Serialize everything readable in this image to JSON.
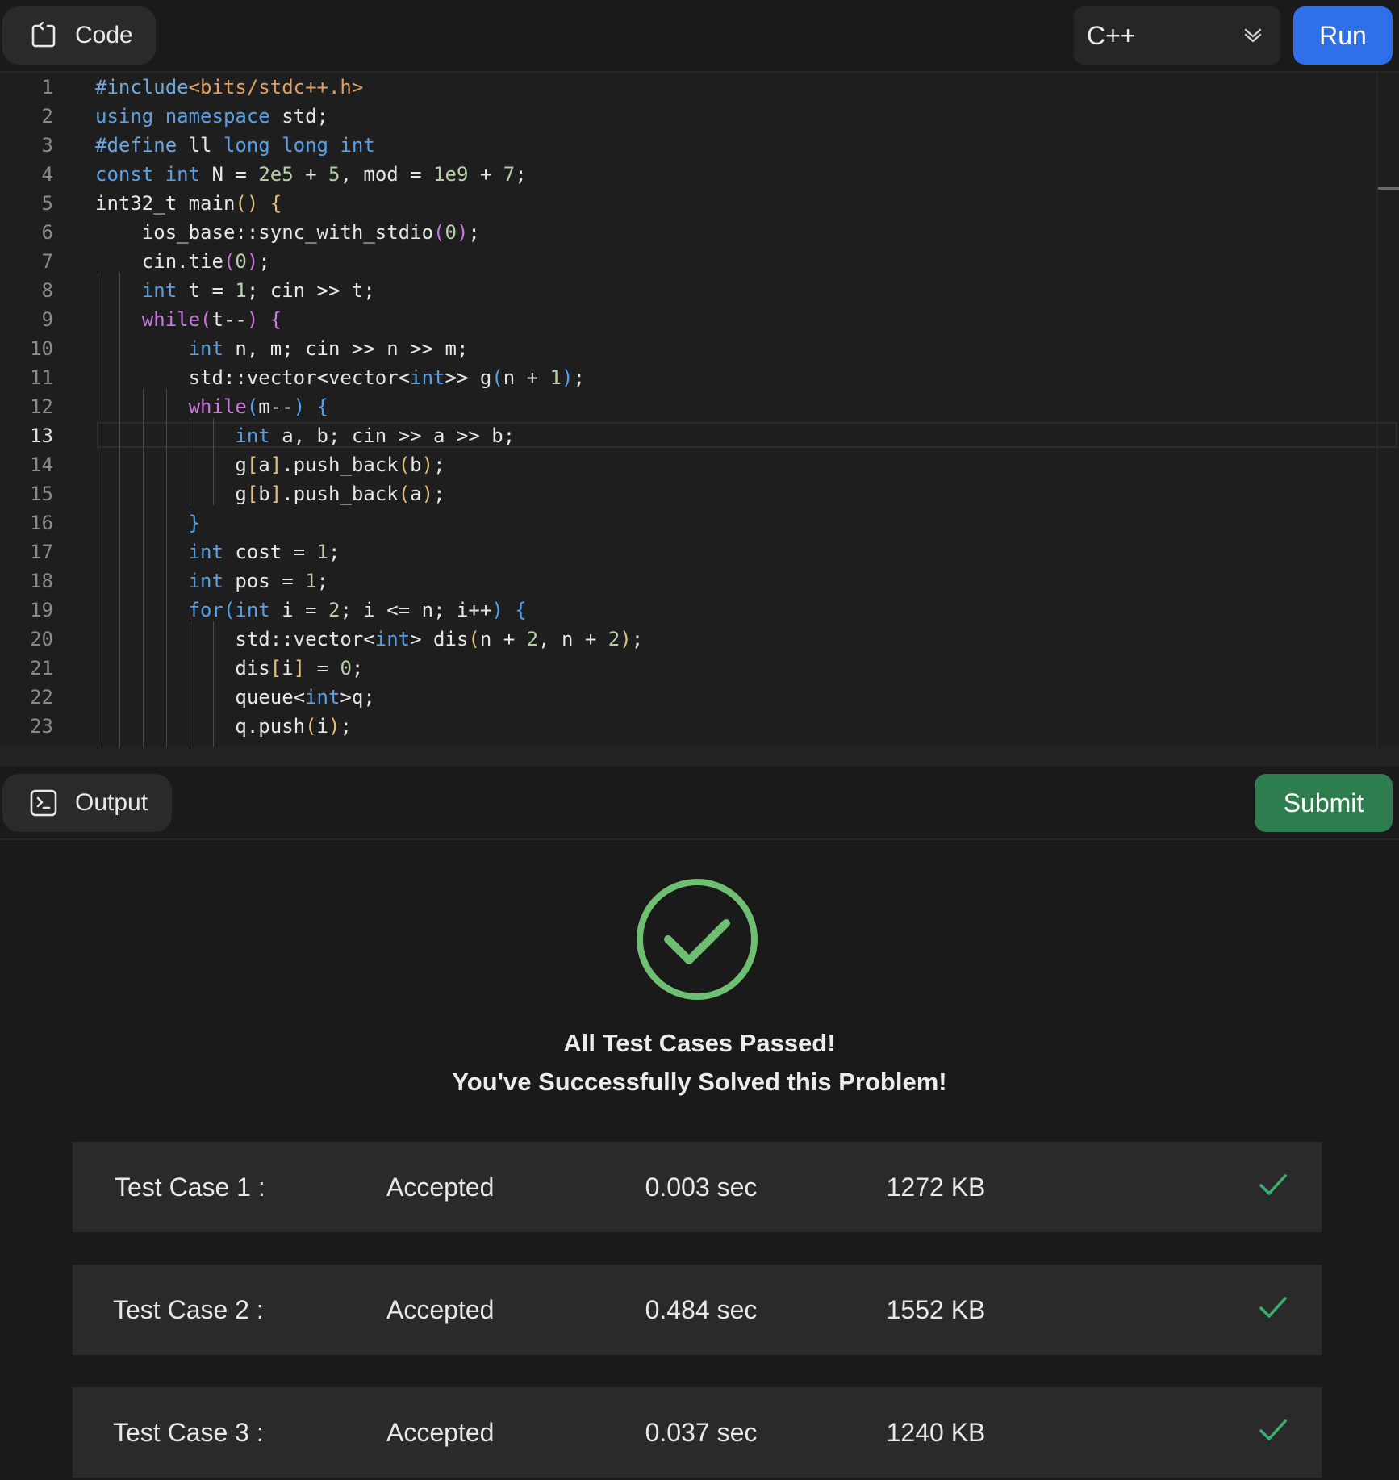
{
  "header": {
    "code_tab_label": "Code",
    "language": "C++",
    "run_label": "Run"
  },
  "editor": {
    "active_line": 13,
    "lines": [
      {
        "n": "1",
        "html": "<span class=\"pp\">#include</span><span class=\"str\">&lt;bits/stdc++.h&gt;</span>"
      },
      {
        "n": "2",
        "html": "<span class=\"kw\">using</span> <span class=\"kw\">namespace</span> std;"
      },
      {
        "n": "3",
        "html": "<span class=\"pp\">#define</span> ll <span class=\"kw\">long</span> <span class=\"kw\">long</span> <span class=\"kw\">int</span>"
      },
      {
        "n": "4",
        "html": "<span class=\"kw\">const</span> <span class=\"kw\">int</span> N = <span class=\"num\">2e5</span> + <span class=\"num\">5</span>, mod = <span class=\"num\">1e9</span> + <span class=\"num\">7</span>;"
      },
      {
        "n": "5",
        "html": "int32_t main<span class=\"p1\">()</span> <span class=\"p1\">{</span>"
      },
      {
        "n": "6",
        "html": "    ios_base::sync_with_stdio<span class=\"p2\">(</span><span class=\"num\">0</span><span class=\"p2\">)</span>;"
      },
      {
        "n": "7",
        "html": "    cin.tie<span class=\"p2\">(</span><span class=\"num\">0</span><span class=\"p2\">)</span>;"
      },
      {
        "n": "8",
        "html": "    <span class=\"kw\">int</span> t = <span class=\"num\">1</span>; cin &gt;&gt; t;"
      },
      {
        "n": "9",
        "html": "    <span class=\"pk\">while</span><span class=\"p2\">(</span>t--<span class=\"p2\">)</span> <span class=\"p2\">{</span>"
      },
      {
        "n": "10",
        "html": "        <span class=\"kw\">int</span> n, m; cin &gt;&gt; n &gt;&gt; m;"
      },
      {
        "n": "11",
        "html": "        std::vector&lt;vector&lt;<span class=\"kw\">int</span>&gt;&gt; g<span class=\"p3\">(</span>n + <span class=\"num\">1</span><span class=\"p3\">)</span>;"
      },
      {
        "n": "12",
        "html": "        <span class=\"pk\">while</span><span class=\"p3\">(</span>m--<span class=\"p3\">)</span> <span class=\"p3\">{</span>"
      },
      {
        "n": "13",
        "html": "            <span class=\"kw\">int</span> a, b; cin &gt;&gt; a &gt;&gt; b;"
      },
      {
        "n": "14",
        "html": "            g<span class=\"p1\">[</span>a<span class=\"p1\">]</span>.push_back<span class=\"p1\">(</span>b<span class=\"p1\">)</span>;"
      },
      {
        "n": "15",
        "html": "            g<span class=\"p1\">[</span>b<span class=\"p1\">]</span>.push_back<span class=\"p1\">(</span>a<span class=\"p1\">)</span>;"
      },
      {
        "n": "16",
        "html": "        <span class=\"p3\">}</span>"
      },
      {
        "n": "17",
        "html": "        <span class=\"kw\">int</span> cost = <span class=\"num\">1</span>;"
      },
      {
        "n": "18",
        "html": "        <span class=\"kw\">int</span> pos = <span class=\"num\">1</span>;"
      },
      {
        "n": "19",
        "html": "        <span class=\"kw\">for</span><span class=\"p3\">(</span><span class=\"kw\">int</span> i = <span class=\"num\">2</span>; i &lt;= n; i++<span class=\"p3\">)</span> <span class=\"p3\">{</span>"
      },
      {
        "n": "20",
        "html": "            std::vector&lt;<span class=\"kw\">int</span>&gt; dis<span class=\"p1\">(</span>n + <span class=\"num\">2</span>, n + <span class=\"num\">2</span><span class=\"p1\">)</span>;"
      },
      {
        "n": "21",
        "html": "            dis<span class=\"p1\">[</span>i<span class=\"p1\">]</span> = <span class=\"num\">0</span>;"
      },
      {
        "n": "22",
        "html": "            queue&lt;<span class=\"kw\">int</span>&gt;q;"
      },
      {
        "n": "23",
        "html": "            q.push<span class=\"p1\">(</span>i<span class=\"p1\">)</span>;"
      }
    ]
  },
  "output": {
    "tab_label": "Output",
    "submit_label": "Submit",
    "message_line1": "All Test Cases Passed!",
    "message_line2": "You've Successfully Solved this Problem!",
    "test_cases": [
      {
        "name": "Test Case 1 :",
        "status": "Accepted",
        "time": "0.003 sec",
        "memory": "1272 KB"
      },
      {
        "name": "Test Case 2 :",
        "status": "Accepted",
        "time": "0.484 sec",
        "memory": "1552 KB"
      },
      {
        "name": "Test Case 3 :",
        "status": "Accepted",
        "time": "0.037 sec",
        "memory": "1240 KB"
      }
    ]
  },
  "colors": {
    "run": "#2f6fe8",
    "submit": "#2e7d4f",
    "success": "#6fbf73"
  }
}
